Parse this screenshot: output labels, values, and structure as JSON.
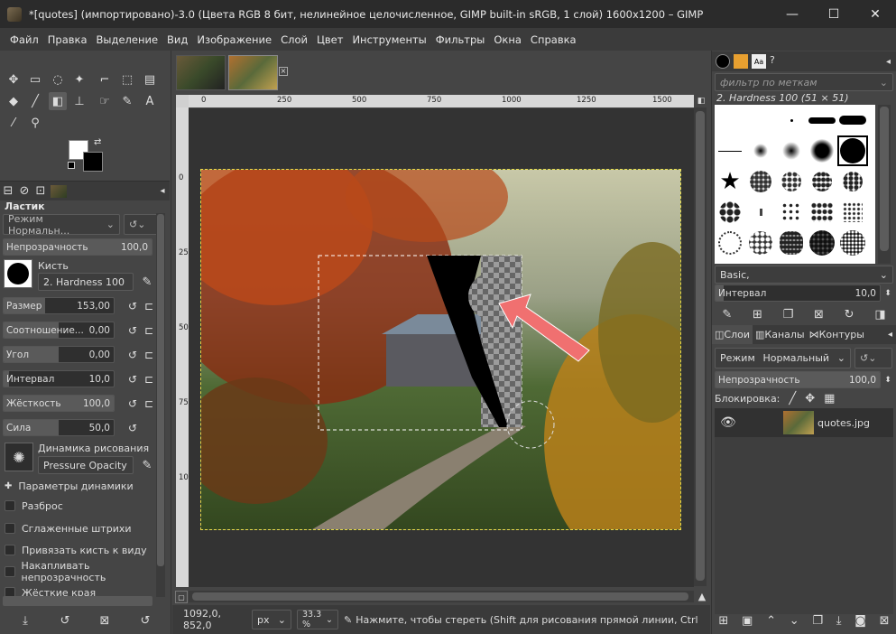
{
  "window": {
    "title": "*[quotes] (импортировано)-3.0 (Цвета RGB 8 бит, нелинейное целочисленное, GIMP built-in sRGB, 1 слой) 1600x1200 – GIMP",
    "minimize": "—",
    "maximize": "☐",
    "close": "✕"
  },
  "menu": [
    "Файл",
    "Правка",
    "Выделение",
    "Вид",
    "Изображение",
    "Слой",
    "Цвет",
    "Инструменты",
    "Фильтры",
    "Окна",
    "Справка"
  ],
  "tool_options": {
    "title": "Ластик",
    "mode_label": "Режим  Нормальн...",
    "opacity_label": "Непрозрачность",
    "opacity_value": "100,0",
    "brush_label": "Кисть",
    "brush_name": "2. Hardness 100",
    "sliders": [
      {
        "label": "Размер",
        "value": "153,00",
        "fill": 0.38
      },
      {
        "label": "Соотношение...",
        "value": "0,00",
        "fill": 0.5
      },
      {
        "label": "Угол",
        "value": "0,00",
        "fill": 0.5
      },
      {
        "label": "Интервал",
        "value": "10,0",
        "fill": 0.05
      },
      {
        "label": "Жёсткость",
        "value": "100,0",
        "fill": 1.0
      },
      {
        "label": "Сила",
        "value": "50,0",
        "fill": 0.5
      }
    ],
    "dynamics_label": "Динамика рисования",
    "dynamics_name": "Pressure Opacity",
    "dynamics_params": "Параметры динамики",
    "checkboxes": [
      "Разброс",
      "Сглаженные штрихи",
      "Привязать кисть к виду",
      "Накапливать непрозрачность",
      "Жёсткие края"
    ]
  },
  "ruler": {
    "top_ticks": [
      "0",
      "250",
      "500",
      "750",
      "1000",
      "1250",
      "1500"
    ],
    "left_ticks": [
      "0",
      "250",
      "500",
      "750",
      "1000"
    ]
  },
  "status": {
    "coords": "1092,0, 852,0",
    "unit": "px",
    "zoom": "33.3 %",
    "message": "Нажмите, чтобы стереть (Shift для рисования прямой линии, Ctrl, ..."
  },
  "brushes": {
    "filter_placeholder": "фильтр по меткам",
    "selected": "2. Hardness 100 (51 × 51)",
    "preset": "Basic,",
    "spacing_label": "Интервал",
    "spacing_value": "10,0"
  },
  "layers": {
    "tabs": [
      "Слои",
      "Каналы",
      "Контуры"
    ],
    "mode_label": "Режим",
    "mode_value": "Нормальный",
    "opacity_label": "Непрозрачность",
    "opacity_value": "100,0",
    "lock_label": "Блокировка:",
    "items": [
      {
        "name": "quotes.jpg"
      }
    ]
  }
}
